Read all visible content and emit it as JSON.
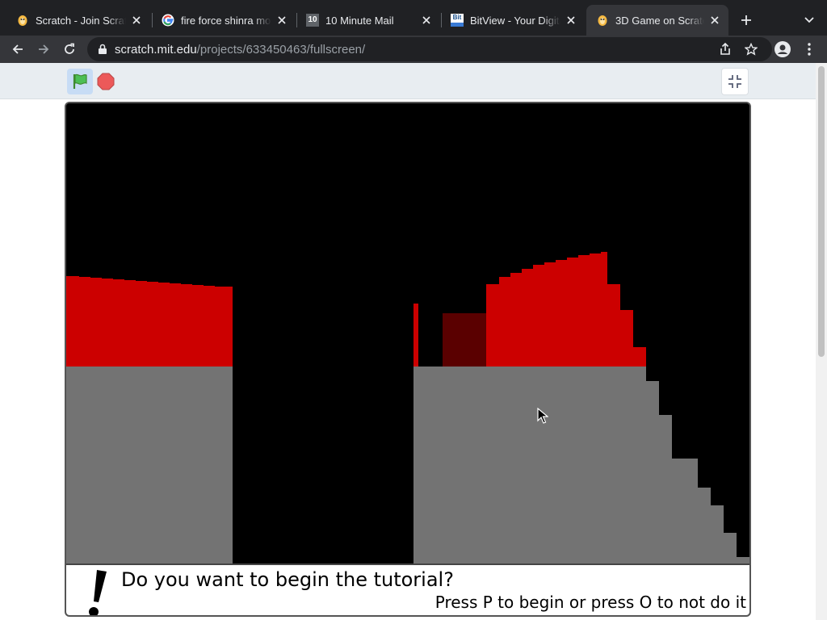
{
  "browser": {
    "tabs": [
      {
        "title": "Scratch - Join Scratch",
        "icon": "scratch-cat-icon",
        "active": false
      },
      {
        "title": "fire force shinra moments",
        "icon": "google-g-icon",
        "active": false
      },
      {
        "title": "10 Minute Mail",
        "icon": "ten-minute-mail-icon",
        "active": false
      },
      {
        "title": "BitView - Your Digital Video Repository",
        "icon": "bitview-icon",
        "active": false
      },
      {
        "title": "3D Game on Scratch",
        "icon": "scratch-cat-icon",
        "active": true
      }
    ],
    "ten_mail_badge": "10",
    "bitview_badge": "Bit",
    "url_host": "scratch.mit.edu",
    "url_path": "/projects/633450463/fullscreen/"
  },
  "scratch_player": {
    "green_flag_icon": "green-flag-icon",
    "stop_icon": "stop-sign-icon",
    "exit_fullscreen_icon": "exit-fullscreen-icon"
  },
  "stage": {
    "dialog_question": "Do you want to begin the tutorial?",
    "dialog_hint": "Press P to begin or press O to not do it",
    "colors": {
      "sky": "#000000",
      "floor": "#737373",
      "wall_bright": "#cc0000",
      "wall_dark": "#5a0000"
    }
  }
}
